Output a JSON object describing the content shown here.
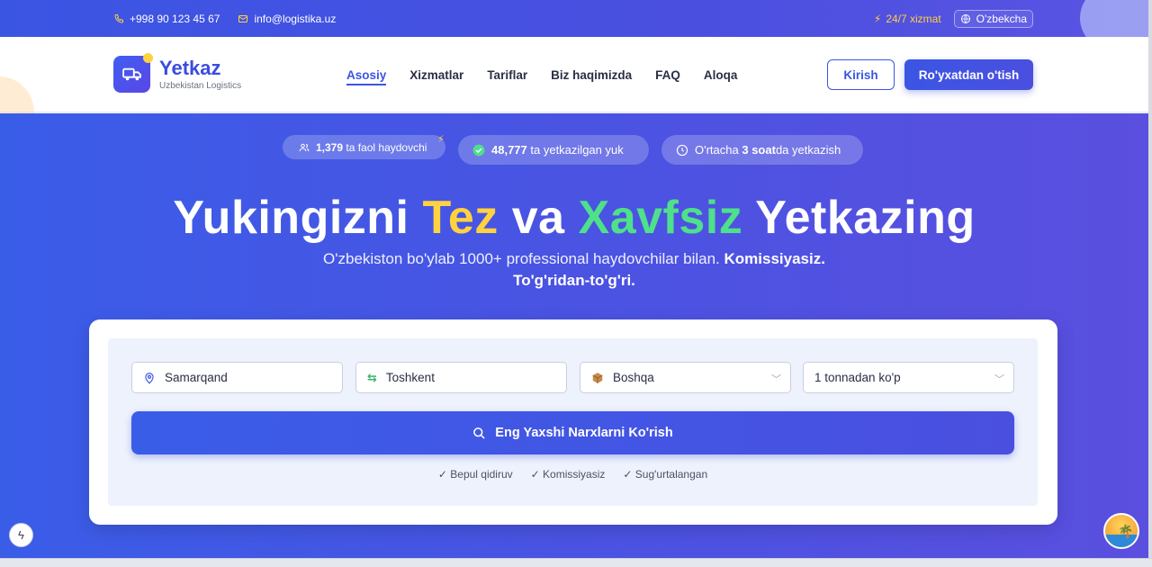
{
  "topbar": {
    "phone": "+998 90 123 45 67",
    "email": "info@logistika.uz",
    "service": "24/7 xizmat",
    "language": "O'zbekcha"
  },
  "brand": {
    "name": "Yetkaz",
    "tagline": "Uzbekistan Logistics"
  },
  "nav": {
    "items": [
      "Asosiy",
      "Xizmatlar",
      "Tariflar",
      "Biz haqimizda",
      "FAQ",
      "Aloqa"
    ],
    "active": "Asosiy",
    "login": "Kirish",
    "register": "Ro'yxatdan o'tish"
  },
  "stats": {
    "drivers_value": "1,379",
    "drivers_label": "ta faol haydovchi",
    "cargo_value": "48,777",
    "cargo_label": "ta yetkazilgan yuk",
    "time_prefix": "O'rtacha",
    "time_value": "3 soat",
    "time_suffix": "da yetkazish"
  },
  "hero": {
    "title_1": "Yukingizni",
    "title_tez": "Tez",
    "title_va": "va",
    "title_xavfsiz": "Xavfsiz",
    "title_2": "Yetkazing",
    "subtitle": "O'zbekiston bo'ylab 1000+ professional haydovchilar bilan.",
    "subtitle_bold": "Komissiyasiz. To'g'ridan-to'g'ri."
  },
  "search": {
    "from": "Samarqand",
    "to": "Toshkent",
    "cargo_type": "Boshqa",
    "weight": "1 tonnadan ko'p",
    "button": "Eng Yaxshi Narxlarni Ko'rish",
    "features": [
      "✓ Bepul qidiruv",
      "✓ Komissiyasiz",
      "✓ Sug'urtalangan"
    ]
  },
  "colors": {
    "primary": "#3b55e3",
    "accent_yellow": "#ffd23f",
    "accent_green": "#4ee08a"
  }
}
